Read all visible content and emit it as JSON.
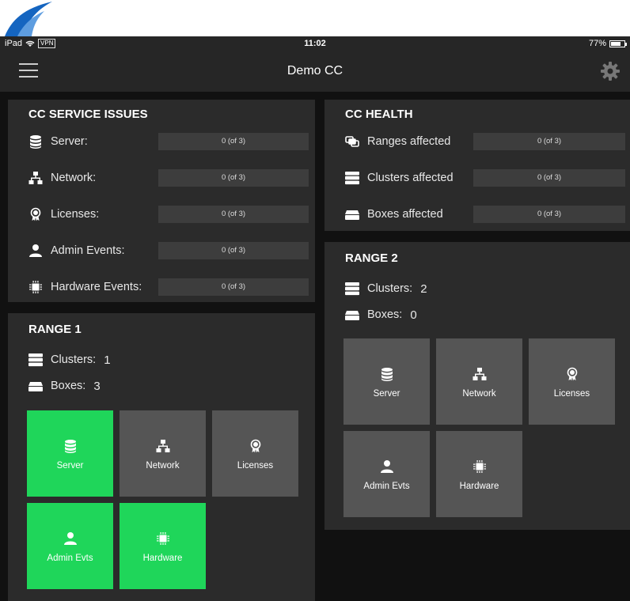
{
  "status": {
    "device": "iPad",
    "vpn": "VPN",
    "time": "11:02",
    "battery": "77%",
    "battery_level": 0.77
  },
  "nav": {
    "title": "Demo CC"
  },
  "service_issues": {
    "title": "CC SERVICE ISSUES",
    "rows": [
      {
        "label": "Server:",
        "value": "0 (of 3)",
        "icon": "database-icon"
      },
      {
        "label": "Network:",
        "value": "0 (of 3)",
        "icon": "network-icon"
      },
      {
        "label": "Licenses:",
        "value": "0 (of 3)",
        "icon": "license-icon"
      },
      {
        "label": "Admin Events:",
        "value": "0 (of 3)",
        "icon": "admin-icon"
      },
      {
        "label": "Hardware Events:",
        "value": "0 (of 3)",
        "icon": "chip-icon"
      }
    ]
  },
  "health": {
    "title": "CC HEALTH",
    "rows": [
      {
        "label": "Ranges affected",
        "value": "0 (of 3)",
        "icon": "ranges-icon"
      },
      {
        "label": "Clusters affected",
        "value": "0 (of 3)",
        "icon": "clusters-icon"
      },
      {
        "label": "Boxes affected",
        "value": "0 (of 3)",
        "icon": "box-icon"
      }
    ]
  },
  "range1": {
    "title": "RANGE 1",
    "clusters_label": "Clusters:",
    "clusters": "1",
    "boxes_label": "Boxes:",
    "boxes": "3",
    "tiles": [
      {
        "label": "Server",
        "status": "ok",
        "icon": "database-icon"
      },
      {
        "label": "Network",
        "status": "neutral",
        "icon": "network-icon"
      },
      {
        "label": "Licenses",
        "status": "neutral",
        "icon": "license-icon"
      },
      {
        "label": "Admin Evts",
        "status": "ok",
        "icon": "admin-icon"
      },
      {
        "label": "Hardware",
        "status": "ok",
        "icon": "chip-icon"
      }
    ]
  },
  "range2": {
    "title": "RANGE 2",
    "clusters_label": "Clusters:",
    "clusters": "2",
    "boxes_label": "Boxes:",
    "boxes": "0",
    "tiles": [
      {
        "label": "Server",
        "status": "neutral",
        "icon": "database-icon"
      },
      {
        "label": "Network",
        "status": "neutral",
        "icon": "network-icon"
      },
      {
        "label": "Licenses",
        "status": "neutral",
        "icon": "license-icon"
      },
      {
        "label": "Admin Evts",
        "status": "neutral",
        "icon": "admin-icon"
      },
      {
        "label": "Hardware",
        "status": "neutral",
        "icon": "chip-icon"
      }
    ]
  },
  "colors": {
    "ok": "#1fd65a",
    "neutral": "#555555",
    "panel": "#2b2b2b",
    "background": "#111111",
    "logo": "#1565c0"
  }
}
